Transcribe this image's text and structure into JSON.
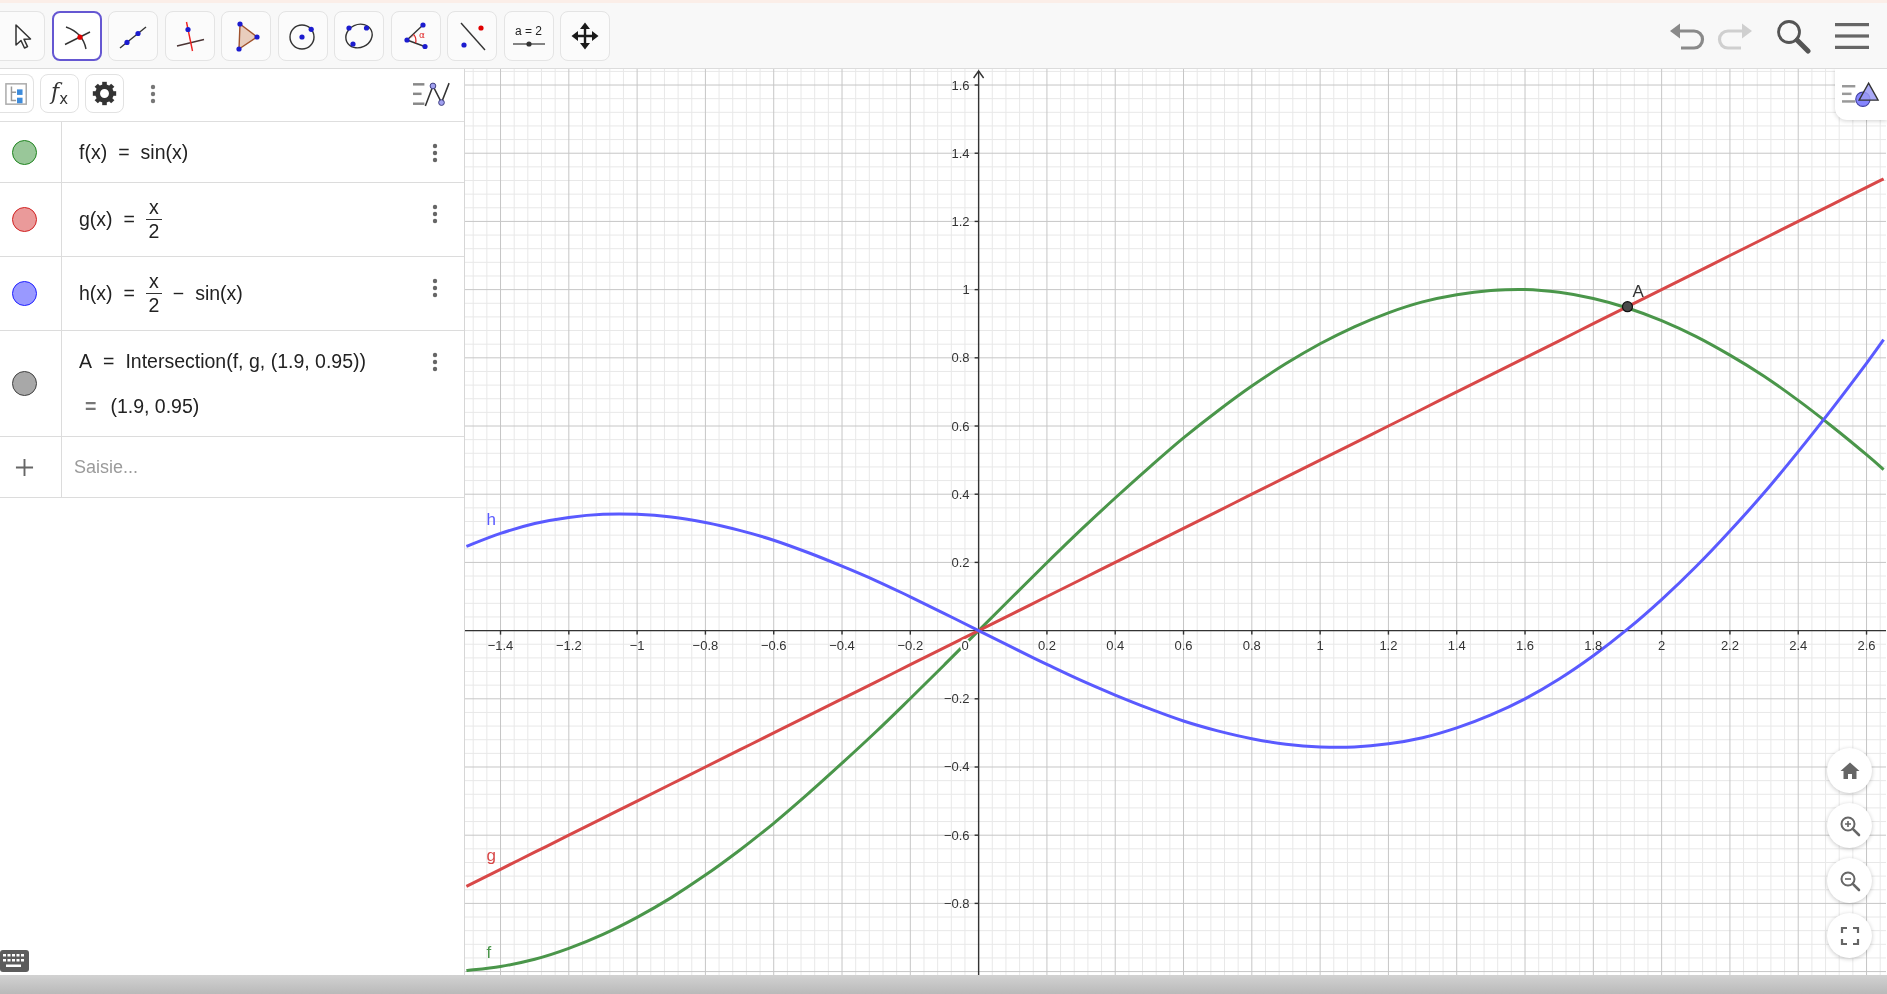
{
  "toolbar": {
    "tools": [
      {
        "kind": "pointer",
        "selected": false
      },
      {
        "kind": "intersect",
        "selected": true
      },
      {
        "kind": "line",
        "selected": false
      },
      {
        "kind": "perpendicular",
        "selected": false
      },
      {
        "kind": "polygon",
        "selected": false
      },
      {
        "kind": "circle-center",
        "selected": false
      },
      {
        "kind": "circle-three-points",
        "selected": false
      },
      {
        "kind": "angle",
        "selected": false,
        "icon_text": "α"
      },
      {
        "kind": "reflect",
        "selected": false
      },
      {
        "kind": "slider",
        "selected": false,
        "icon_text": "a = 2"
      },
      {
        "kind": "move-view",
        "selected": false
      }
    ],
    "undo": {
      "disabled": false
    },
    "redo": {
      "disabled": true
    }
  },
  "algebra_view": {
    "header": {
      "fx_label": "f$_{x}$"
    },
    "items": [
      {
        "color": "#99c799",
        "visible": true,
        "definition": [
          {
            "kind": "text",
            "text": "f(x)"
          },
          {
            "kind": "operator",
            "text": "="
          },
          {
            "kind": "text",
            "text": "sin(x)"
          }
        ]
      },
      {
        "color": "#ea9a9a",
        "visible": true,
        "definition": [
          {
            "kind": "text",
            "text": "g(x)"
          },
          {
            "kind": "operator",
            "text": "="
          },
          {
            "kind": "fraction",
            "numerator": "x",
            "denominator": "2"
          }
        ]
      },
      {
        "color": "#9999ff",
        "visible": true,
        "definition": [
          {
            "kind": "text",
            "text": "h(x)"
          },
          {
            "kind": "operator",
            "text": "="
          },
          {
            "kind": "fraction",
            "numerator": "x",
            "denominator": "2"
          },
          {
            "kind": "operator",
            "text": "−"
          },
          {
            "kind": "text",
            "text": "sin(x)"
          }
        ]
      },
      {
        "color": "#a8a8a8",
        "visible": true,
        "definition": [
          {
            "kind": "text",
            "text": "A"
          },
          {
            "kind": "operator",
            "text": "="
          },
          {
            "kind": "text",
            "text": "Intersection(f, g, (1.9, 0.95))"
          }
        ],
        "output": [
          {
            "kind": "operator",
            "text": "="
          },
          {
            "kind": "text",
            "text": "(1.9, 0.95)"
          }
        ]
      }
    ],
    "input": {
      "placeholder": "Saisie..."
    }
  },
  "graphics_view": {
    "origin_label": "0",
    "chart_data": {
      "type": "line",
      "grid": true,
      "x": [
        -1.5,
        -1.4,
        -1.3,
        -1.2,
        -1.1,
        -1.0,
        -0.9,
        -0.8,
        -0.7,
        -0.6,
        -0.5,
        -0.4,
        -0.3,
        -0.2,
        -0.1,
        0,
        0.1,
        0.2,
        0.3,
        0.4,
        0.5,
        0.6,
        0.7,
        0.8,
        0.9,
        1.0,
        1.1,
        1.2,
        1.3,
        1.4,
        1.5,
        1.6,
        1.7,
        1.8,
        1.9,
        2.0,
        2.1,
        2.2,
        2.3,
        2.4,
        2.5,
        2.6,
        2.65
      ],
      "series": [
        {
          "name": "f",
          "color": "#4a964a",
          "values": [
            -0.997,
            -0.985,
            -0.964,
            -0.932,
            -0.891,
            -0.841,
            -0.783,
            -0.717,
            -0.644,
            -0.565,
            -0.479,
            -0.389,
            -0.296,
            -0.199,
            -0.1,
            0,
            0.1,
            0.199,
            0.296,
            0.389,
            0.479,
            0.565,
            0.644,
            0.717,
            0.783,
            0.841,
            0.891,
            0.932,
            0.964,
            0.985,
            0.997,
            1.0,
            0.992,
            0.974,
            0.946,
            0.909,
            0.863,
            0.808,
            0.746,
            0.675,
            0.598,
            0.516,
            0.472
          ]
        },
        {
          "name": "g",
          "color": "#d84848",
          "values": [
            -0.75,
            -0.7,
            -0.65,
            -0.6,
            -0.55,
            -0.5,
            -0.45,
            -0.4,
            -0.35,
            -0.3,
            -0.25,
            -0.2,
            -0.15,
            -0.1,
            -0.05,
            0,
            0.05,
            0.1,
            0.15,
            0.2,
            0.25,
            0.3,
            0.35,
            0.4,
            0.45,
            0.5,
            0.55,
            0.6,
            0.65,
            0.7,
            0.75,
            0.8,
            0.85,
            0.9,
            0.95,
            1.0,
            1.05,
            1.1,
            1.15,
            1.2,
            1.25,
            1.3,
            1.325
          ]
        },
        {
          "name": "h",
          "color": "#5a5aff",
          "values": [
            0.247,
            0.285,
            0.314,
            0.332,
            0.341,
            0.341,
            0.333,
            0.317,
            0.294,
            0.265,
            0.229,
            0.189,
            0.146,
            0.099,
            0.05,
            0,
            -0.05,
            -0.099,
            -0.146,
            -0.189,
            -0.229,
            -0.265,
            -0.294,
            -0.317,
            -0.333,
            -0.341,
            -0.341,
            -0.332,
            -0.314,
            -0.285,
            -0.247,
            -0.2,
            -0.142,
            -0.074,
            0.004,
            0.091,
            0.187,
            0.292,
            0.404,
            0.525,
            0.652,
            0.784,
            0.853
          ]
        }
      ],
      "xlim": [
        -1.504,
        2.657
      ],
      "ylim": [
        -1.01,
        1.647
      ],
      "xticks": [
        {
          "value": -1.4,
          "label": "−1.4"
        },
        {
          "value": -1.2,
          "label": "−1.2"
        },
        {
          "value": -1,
          "label": "−1"
        },
        {
          "value": -0.8,
          "label": "−0.8"
        },
        {
          "value": -0.6,
          "label": "−0.6"
        },
        {
          "value": -0.4,
          "label": "−0.4"
        },
        {
          "value": -0.2,
          "label": "−0.2"
        },
        0.2,
        0.4,
        0.6,
        0.8,
        1,
        1.2,
        1.4,
        1.6,
        1.8,
        2,
        2.2,
        2.4,
        2.6
      ],
      "yticks": [
        1.6,
        1.4,
        1.2,
        1,
        0.8,
        0.6,
        0.4,
        0.2,
        {
          "value": -0.2,
          "label": "−0.2"
        },
        {
          "value": -0.4,
          "label": "−0.4"
        },
        {
          "value": -0.6,
          "label": "−0.6"
        },
        {
          "value": -0.8,
          "label": "−0.8"
        }
      ],
      "annotations": [
        {
          "text": "A",
          "x": 1.9,
          "y": 0.95
        }
      ]
    }
  }
}
